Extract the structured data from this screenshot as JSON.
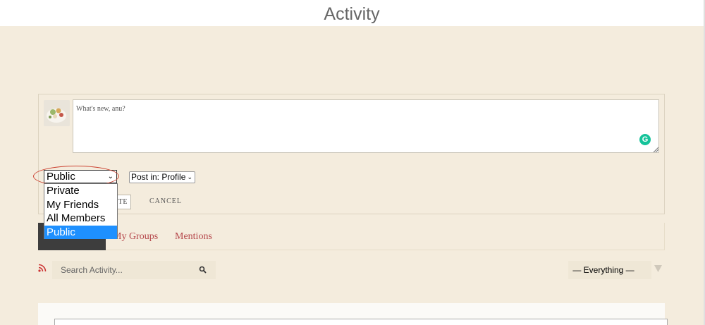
{
  "page": {
    "title": "Activity"
  },
  "post_form": {
    "textarea_placeholder": "What's new, anu?",
    "grammarly_letter": "G",
    "privacy": {
      "selected": "Public",
      "options": [
        "Private",
        "My Friends",
        "All Members",
        "Public"
      ]
    },
    "post_in": {
      "selected": "Post in: Profile"
    },
    "post_button_label": "TE",
    "cancel_label": "CANCEL"
  },
  "tabs": [
    {
      "label": "My Groups"
    },
    {
      "label": "Mentions"
    }
  ],
  "search": {
    "placeholder": "Search Activity..."
  },
  "filter": {
    "selected": "— Everything —"
  },
  "colors": {
    "background": "#f4ecdd",
    "tab_link": "#b5474b",
    "dropdown_selected": "#1e90ff",
    "rss": "#cc3333",
    "highlight_ring": "#cc4433"
  },
  "icons": [
    "avatar",
    "grammarly-icon",
    "resize-icon",
    "chevron-down-icon",
    "rss-icon",
    "search-icon",
    "filter-arrow-icon"
  ]
}
